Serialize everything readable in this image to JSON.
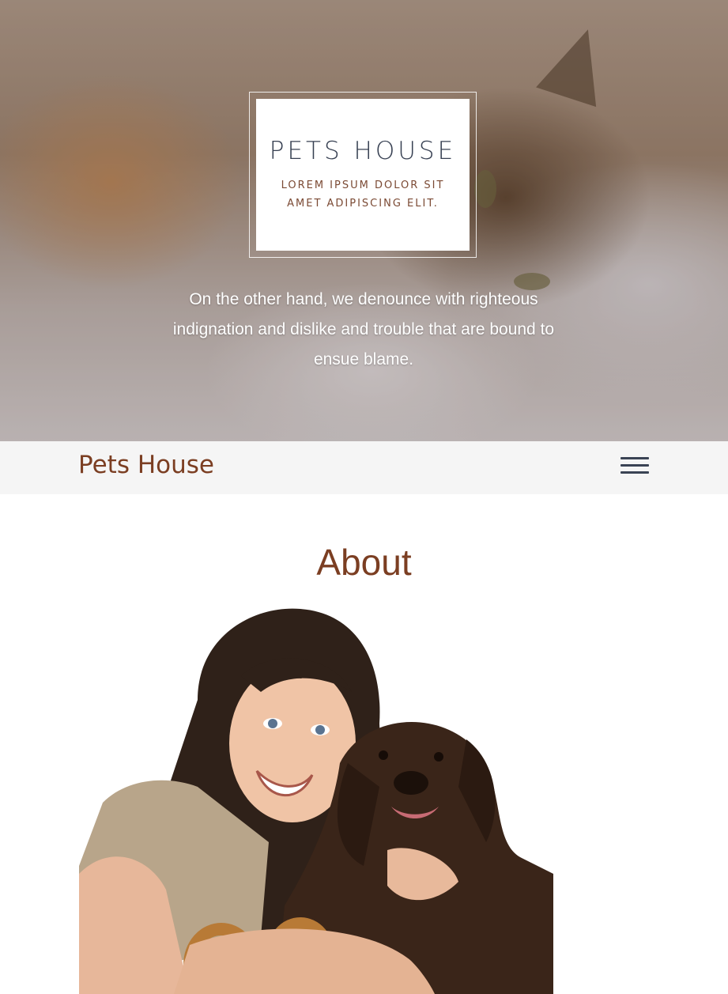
{
  "hero": {
    "title": "PETS HOUSE",
    "subtitle": "LOREM IPSUM DOLOR SIT AMET ADIPISCING ELIT.",
    "text": "On the other hand, we denounce with righteous indignation and dislike and trouble that are bound to ensue blame."
  },
  "navbar": {
    "brand": "Pets House",
    "menu_icon": "hamburger-menu-icon"
  },
  "about": {
    "title": "About"
  },
  "colors": {
    "brand_brown": "#7b3e22",
    "navbar_bg": "#f5f5f5",
    "dark_slate": "#374052"
  }
}
